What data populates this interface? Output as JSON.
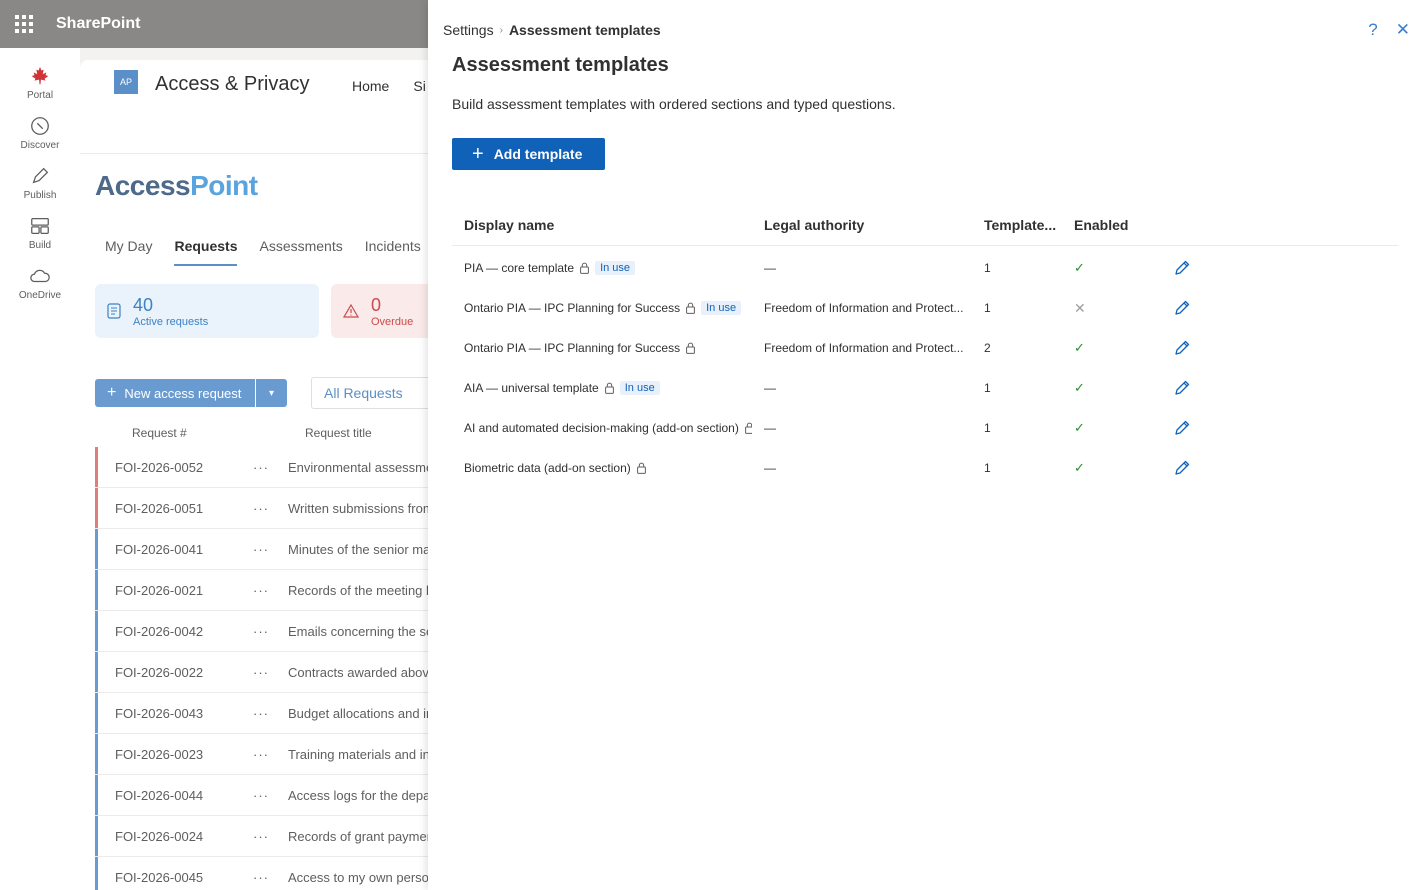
{
  "suite": {
    "app_name": "SharePoint"
  },
  "appbar": {
    "items": [
      {
        "label": "Portal",
        "icon": "maple-leaf-icon"
      },
      {
        "label": "Discover",
        "icon": "compass-icon"
      },
      {
        "label": "Publish",
        "icon": "pen-icon"
      },
      {
        "label": "Build",
        "icon": "grid-icon"
      },
      {
        "label": "OneDrive",
        "icon": "cloud-icon"
      }
    ]
  },
  "site": {
    "logo_text": "AP",
    "name": "Access & Privacy",
    "nav": [
      "Home",
      "Si"
    ],
    "brand_a": "Access",
    "brand_b": "Point",
    "pivots": [
      "My Day",
      "Requests",
      "Assessments",
      "Incidents"
    ],
    "kpis": [
      {
        "num": "40",
        "label": "Active requests"
      },
      {
        "num": "0",
        "label": "Overdue"
      }
    ],
    "new_request_label": "New access request",
    "all_requests_label": "All Requests",
    "col_request_num": "Request #",
    "col_request_title": "Request title",
    "requests": [
      {
        "id": "FOI-2026-0052",
        "title": "Environmental assessment",
        "status": "red"
      },
      {
        "id": "FOI-2026-0051",
        "title": "Written submissions from",
        "status": "red"
      },
      {
        "id": "FOI-2026-0041",
        "title": "Minutes of the senior ma",
        "status": "blue"
      },
      {
        "id": "FOI-2026-0021",
        "title": "Records of the meeting b",
        "status": "blue"
      },
      {
        "id": "FOI-2026-0042",
        "title": "Emails concerning the se",
        "status": "blue"
      },
      {
        "id": "FOI-2026-0022",
        "title": "Contracts awarded above",
        "status": "blue"
      },
      {
        "id": "FOI-2026-0043",
        "title": "Budget allocations and in",
        "status": "blue"
      },
      {
        "id": "FOI-2026-0023",
        "title": "Training materials and in",
        "status": "blue"
      },
      {
        "id": "FOI-2026-0044",
        "title": "Access logs for the depa",
        "status": "blue"
      },
      {
        "id": "FOI-2026-0024",
        "title": "Records of grant paymen",
        "status": "blue"
      },
      {
        "id": "FOI-2026-0045",
        "title": "Access to my own perso",
        "status": "blue"
      }
    ]
  },
  "panel": {
    "breadcrumb_root": "Settings",
    "breadcrumb_current": "Assessment templates",
    "title": "Assessment templates",
    "description": "Build assessment templates with ordered sections and typed questions.",
    "add_label": "Add template",
    "columns": {
      "display_name": "Display name",
      "legal_authority": "Legal authority",
      "template_version": "Template...",
      "enabled": "Enabled"
    },
    "in_use_label": "In use",
    "rows": [
      {
        "name": "PIA — core template",
        "in_use": true,
        "authority": "—",
        "version": "1",
        "enabled": true
      },
      {
        "name": "Ontario PIA — IPC Planning for Success",
        "in_use": true,
        "authority": "Freedom of Information and Protect...",
        "version": "1",
        "enabled": false
      },
      {
        "name": "Ontario PIA — IPC Planning for Success",
        "in_use": false,
        "authority": "Freedom of Information and Protect...",
        "version": "2",
        "enabled": true
      },
      {
        "name": "AIA — universal template",
        "in_use": true,
        "authority": "—",
        "version": "1",
        "enabled": true
      },
      {
        "name": "AI and automated decision-making (add-on section)",
        "in_use": false,
        "authority": "—",
        "version": "1",
        "enabled": true
      },
      {
        "name": "Biometric data (add-on section)",
        "in_use": false,
        "authority": "—",
        "version": "1",
        "enabled": true
      }
    ]
  },
  "colors": {
    "suite_bg": "#8a8886",
    "primary": "#0f62b8",
    "status_red": "#e07d7d",
    "status_blue": "#6a9bd0",
    "check": "#2f8a2f"
  }
}
